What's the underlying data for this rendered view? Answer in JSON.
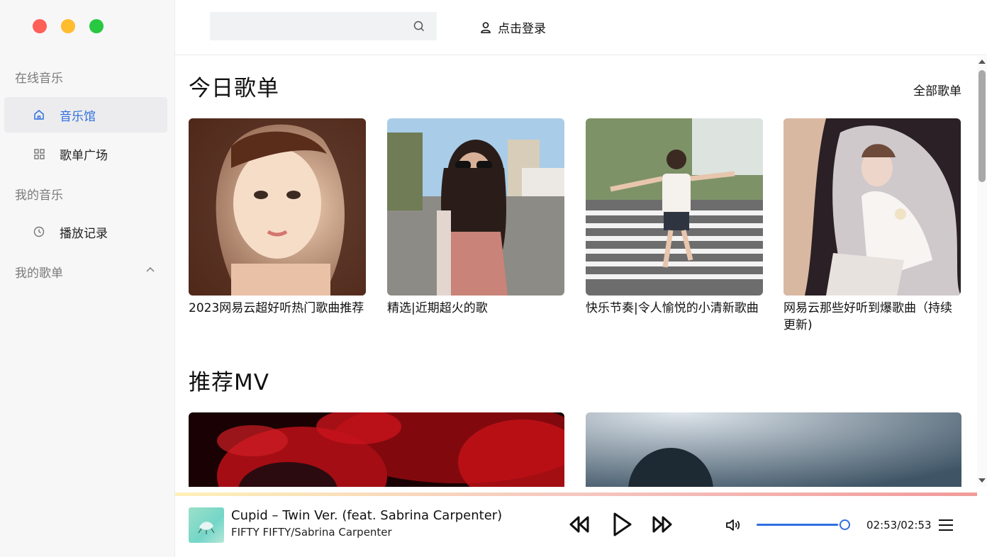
{
  "sidebar": {
    "section_online": "在线音乐",
    "item_music_hall": "音乐馆",
    "item_playlist_square": "歌单广场",
    "section_my_music": "我的音乐",
    "item_play_history": "播放记录",
    "section_my_playlists": "我的歌单"
  },
  "topbar": {
    "search_placeholder": "",
    "login_label": "点击登录"
  },
  "today_playlists": {
    "title": "今日歌单",
    "all_link": "全部歌单",
    "cards": [
      {
        "title": "2023网易云超好听热门歌曲推荐"
      },
      {
        "title": "精选|近期超火的歌"
      },
      {
        "title": "快乐节奏|令人愉悦的小清新歌曲"
      },
      {
        "title": "网易云那些好听到爆歌曲（持续更新)"
      }
    ]
  },
  "recommended_mv": {
    "title": "推荐MV"
  },
  "player": {
    "song_title": "Cupid – Twin Ver. (feat. Sabrina Carpenter)",
    "artist": "FIFTY FIFTY/Sabrina Carpenter",
    "time": "02:53/02:53",
    "progress": 1.0,
    "volume": 0.92
  },
  "colors": {
    "accent": "#2f6fe0",
    "sidebar_bg": "#f7f7f8",
    "active_item_bg": "#ececee"
  }
}
